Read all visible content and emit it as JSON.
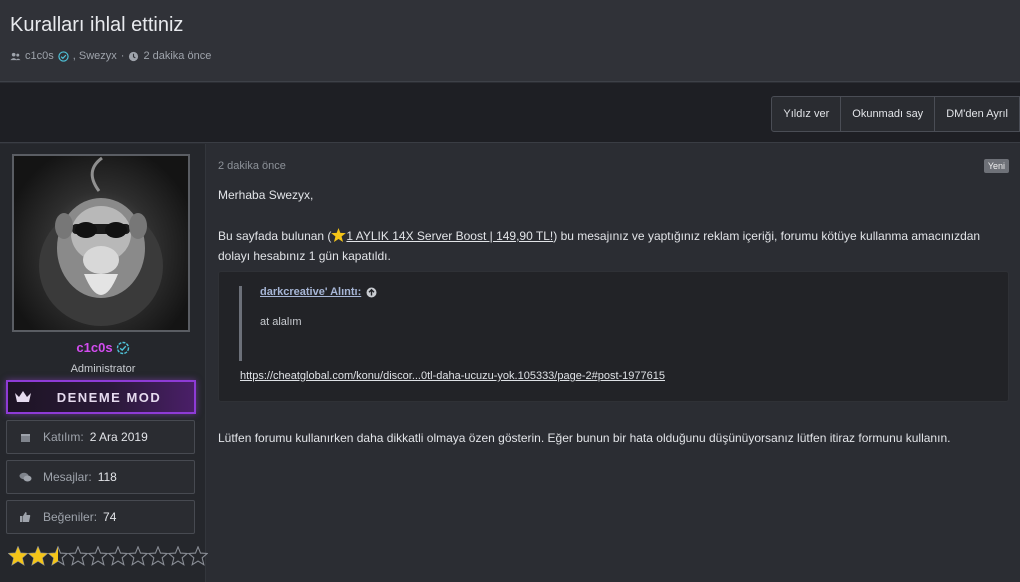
{
  "thread": {
    "title": "Kuralları ihlal ettiniz",
    "participants": "c1c0s",
    "participants_2": ", Swezyx",
    "separator": "·",
    "time": "2 dakika önce"
  },
  "actions": [
    {
      "label": "Yıldız ver"
    },
    {
      "label": "Okunmadı say"
    },
    {
      "label": "DM'den Ayrıl"
    }
  ],
  "user": {
    "name": "c1c0s",
    "role": "Administrator",
    "banner": "DENEME MOD",
    "stats": [
      {
        "key": "Katılım:",
        "value": "2 Ara 2019"
      },
      {
        "key": "Mesajlar:",
        "value": "118"
      },
      {
        "key": "Beğeniler:",
        "value": "74"
      }
    ],
    "rating": {
      "value": 2.5,
      "max": 10
    }
  },
  "post": {
    "date": "2 dakika önce",
    "badge": "Yeni",
    "greeting": "Merhaba Swezyx,",
    "para_prefix": "Bu sayfada bulunan (",
    "para_link": "1 AYLIK 14X Server Boost | 149,90 TL!",
    "para_suffix": ") bu mesajınız ve yaptığınız reklam içeriği, forumu kötüye kullanma amacınızdan dolayı hesabınız 1 gün kapatıldı.",
    "quote": {
      "author": "darkcreative' Alıntı:",
      "text": "at alalım",
      "link": "https://cheatglobal.com/konu/discor...0tl-daha-ucuzu-yok.105333/page-2#post-1977615"
    },
    "closing": "Lütfen forumu kullanırken daha dikkatli olmaya özen gösterin. Eğer bunun bir hata olduğunu düşünüyorsanız lütfen itiraz formunu kullanın."
  },
  "colors": {
    "username": "#d34cf0",
    "banner_border": "#8e3bd6",
    "star": "#f5c518",
    "quote_author": "#a7b6d6"
  }
}
